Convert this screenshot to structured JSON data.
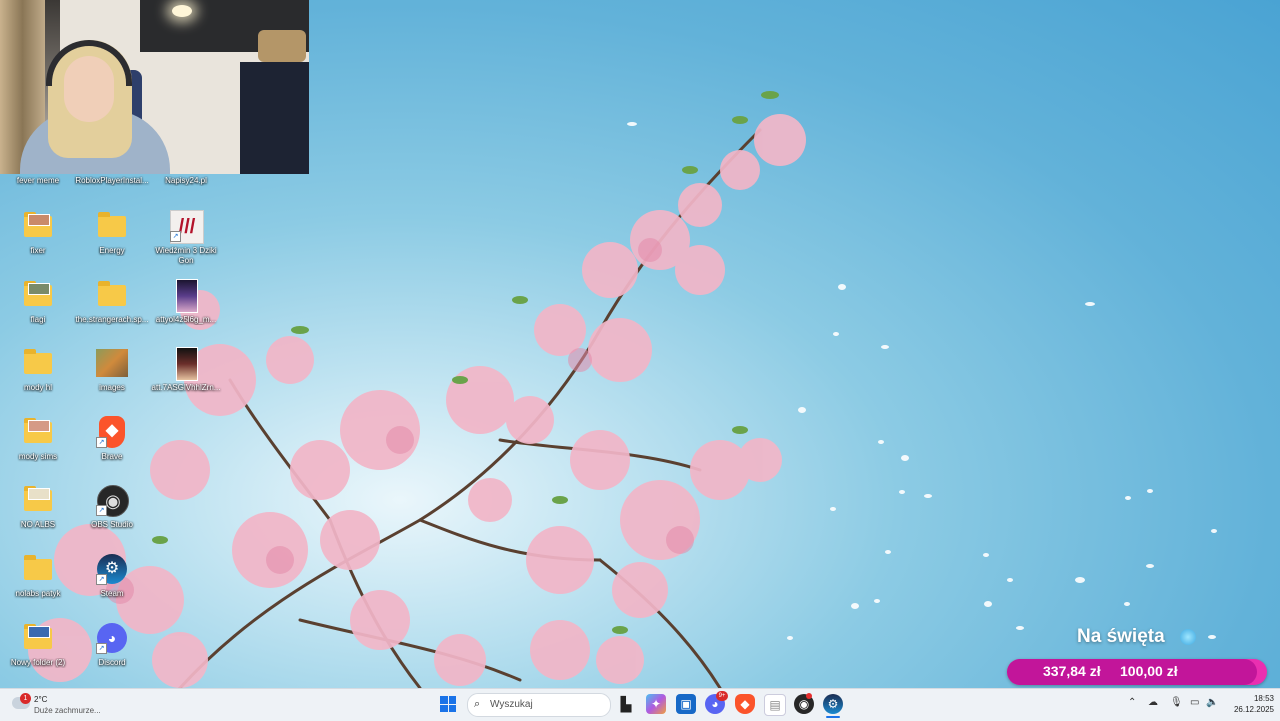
{
  "webcam": {},
  "desktop": {
    "top_labels": [
      "fever meme",
      "RobloxPlayerInstal...",
      "Napisy24.pl"
    ],
    "icons": {
      "fixer": "fixer",
      "energy": "Energy",
      "wiedzmin": "Wiedźmin 3 Dziki Gon",
      "flagi": "flagi",
      "strangerach": "the.strangerach.sp...",
      "attyol": "attyol4z5l6g_m...",
      "mody_hl": "mody hl",
      "images": "images",
      "atto": "att.7ASGlVhhlZrn...",
      "mody_sims": "mody sims",
      "brave": "Brave",
      "no_alb": "NO ALBS",
      "obs": "OBS Studio",
      "nolabs": "nolabs patyk",
      "steam": "Steam",
      "nowy_folder": "Nowy folder (2)",
      "discord": "Discord"
    }
  },
  "donation": {
    "title": "Na święta",
    "current": "337,84 zł",
    "goal": "100,00 zł",
    "progress_fraction": 0.96,
    "accent": "#ea2fb0"
  },
  "taskbar": {
    "weather_badge": "1",
    "temperature": "2°C",
    "weather_desc": "Duże zachmurze...",
    "search_placeholder": "Wyszukaj",
    "discord_badge": "9+",
    "time": "18:53",
    "date": "26.12.2025"
  }
}
